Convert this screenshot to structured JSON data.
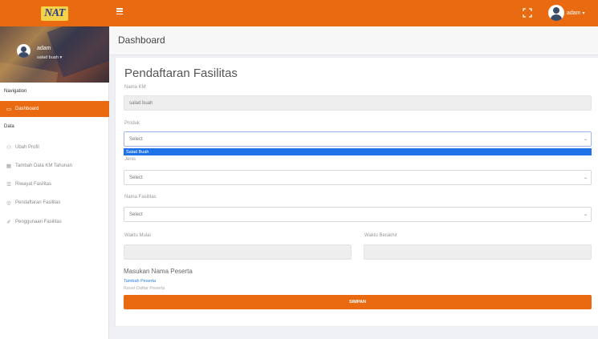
{
  "topbar": {
    "logo_text": "NAT",
    "user_name": "adam",
    "caret": "▾",
    "icons": {
      "menu": "hamburger-icon",
      "expand": "fullscreen-icon",
      "avatar": "user-avatar-icon"
    }
  },
  "sidebar": {
    "profile": {
      "name": "adam",
      "subtitle": "salad buah ▾"
    },
    "navigation_label": "Navigation",
    "data_label": "Data",
    "items": [
      {
        "label": "Dashboard",
        "icon": "▭",
        "icon_name": "monitor-icon",
        "active": true
      },
      {
        "label": "Ubah Profil",
        "icon": "⚇",
        "icon_name": "user-icon",
        "active": false
      },
      {
        "label": "Tambah Data KM Tahunan",
        "icon": "▦",
        "icon_name": "table-icon",
        "active": false
      },
      {
        "label": "Riwayat Fasilitas",
        "icon": "☰",
        "icon_name": "list-icon",
        "active": false
      },
      {
        "label": "Pendaftaran Fasilitas",
        "icon": "◎",
        "icon_name": "register-icon",
        "active": false
      },
      {
        "label": "Penggunaan Fasilitas",
        "icon": "✐",
        "icon_name": "edit-icon",
        "active": false
      }
    ]
  },
  "page": {
    "title": "Dashboard"
  },
  "form": {
    "title": "Pendaftaran Fasilitas",
    "nama_km": {
      "label": "Nama KM",
      "value": "salad buah"
    },
    "produk": {
      "label": "Produk",
      "value": "Select",
      "open_option": "Salad Buah"
    },
    "jenis": {
      "label": "Jenis",
      "value": "Select"
    },
    "nama_fasilitas": {
      "label": "Nama Fasilitas",
      "value": "Select"
    },
    "waktu_mulai": {
      "label": "Waktu Mulai",
      "value": ""
    },
    "waktu_berakhir": {
      "label": "Waktu Berakhir",
      "value": ""
    },
    "peserta": {
      "title": "Masukan Nama Peserta",
      "add_link": "Tambah Peserta",
      "reset_link": "Reset Daftar Peserta"
    },
    "submit_label": "SIMPAN",
    "select_arrow": "⌄"
  }
}
